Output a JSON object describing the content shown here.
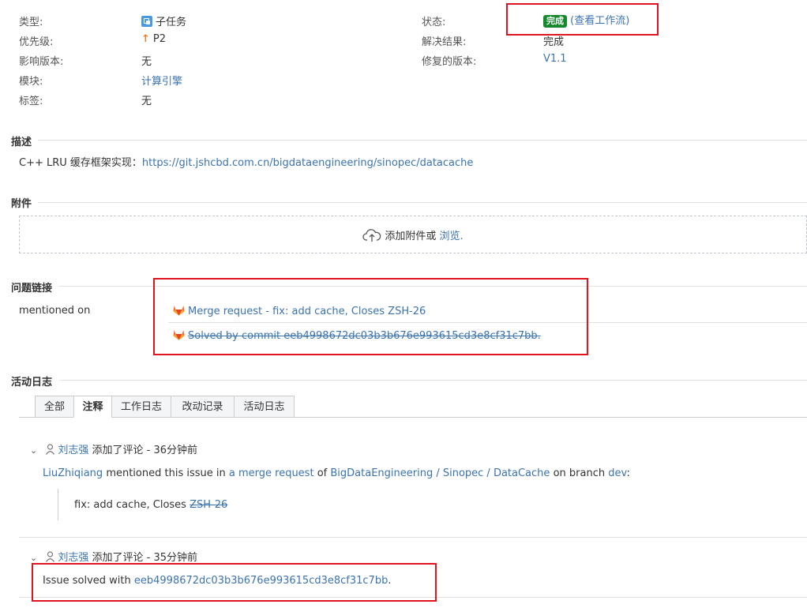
{
  "details": {
    "type_label": "类型:",
    "type_value": "子任务",
    "priority_label": "优先级:",
    "priority_value": "P2",
    "affects_label": "影响版本:",
    "affects_value": "无",
    "component_label": "模块:",
    "component_value": "计算引擎",
    "labels_label": "标签:",
    "labels_value": "无",
    "status_label": "状态:",
    "status_badge": "完成",
    "status_link": "(查看工作流)",
    "resolution_label": "解决结果:",
    "resolution_value": "完成",
    "fix_version_label": "修复的版本:",
    "fix_version_value": "V1.1"
  },
  "description": {
    "title": "描述",
    "text": "C++ LRU 缓存框架实现：",
    "link": "https://git.jshcbd.com.cn/bigdataengineering/sinopec/datacache"
  },
  "attachments": {
    "title": "附件",
    "drop_text": "添加附件或",
    "browse_link": "浏览."
  },
  "issue_links": {
    "title": "问题链接",
    "relation": "mentioned on",
    "items": [
      {
        "text": "Merge request - fix: add cache, Closes ZSH-26"
      },
      {
        "text": "Solved by commit eeb4998672dc03b3b676e993615cd3e8cf31c7bb."
      }
    ]
  },
  "activity": {
    "title": "活动日志",
    "tabs": [
      "全部",
      "注释",
      "工作日志",
      "改动记录",
      "活动日志"
    ],
    "active_tab": "注释",
    "comments": [
      {
        "author": "刘志强",
        "action": "添加了评论 - 36分钟前",
        "body": {
          "user": "LiuZhiqiang",
          "t1": "mentioned this issue in",
          "mr_link": "a merge request",
          "t2": "of",
          "repo_link": "BigDataEngineering / Sinopec / DataCache",
          "t3": "on branch",
          "branch_link": "dev",
          "t4": ":",
          "quote_text": "fix: add cache, Closes",
          "quote_link": "ZSH-26"
        }
      },
      {
        "author": "刘志强",
        "action": "添加了评论 - 35分钟前",
        "body": {
          "text": "Issue solved with",
          "commit_link": "eeb4998672dc03b3b676e993615cd3e8cf31c7bb",
          "end": "."
        }
      }
    ]
  },
  "colors": {
    "link": "#3b73af",
    "status_badge": "#14892c",
    "highlight_box": "#e0141e",
    "gitlab_orange": "#fc6d26"
  }
}
